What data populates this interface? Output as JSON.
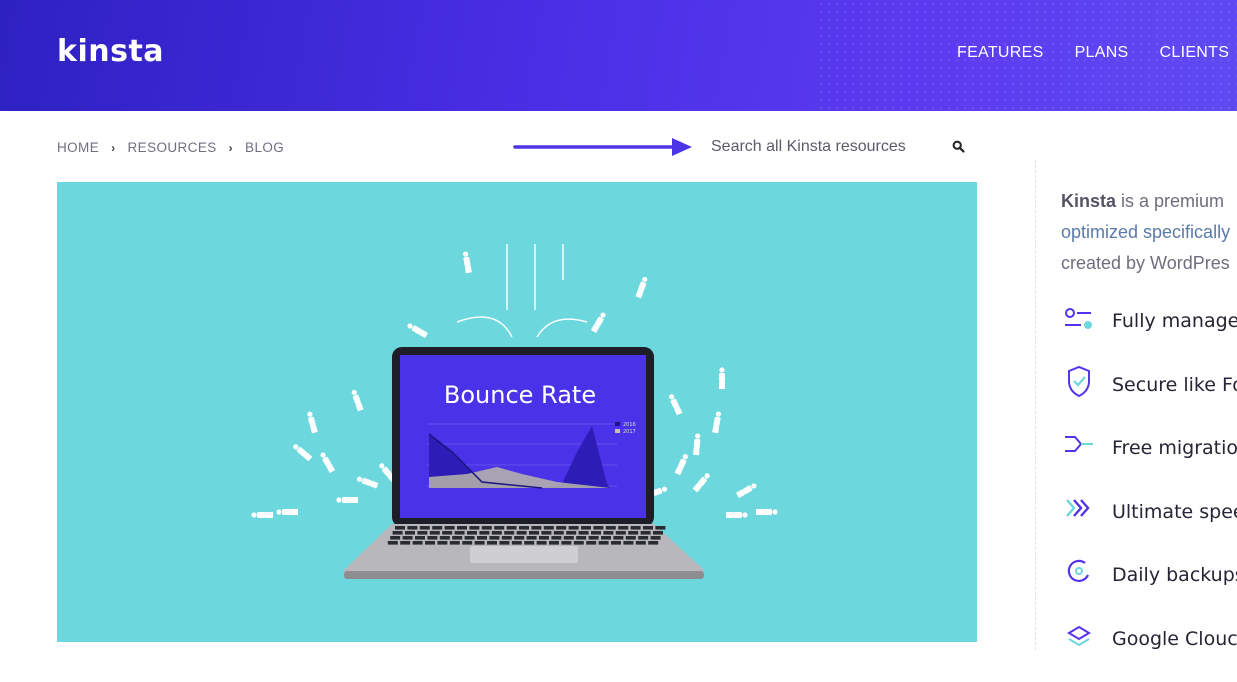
{
  "header": {
    "logo": "kinsta",
    "nav": [
      {
        "label": "FEATURES"
      },
      {
        "label": "PLANS"
      },
      {
        "label": "CLIENTS"
      }
    ]
  },
  "breadcrumb": {
    "items": [
      {
        "label": "HOME"
      },
      {
        "label": "RESOURCES"
      },
      {
        "label": "BLOG"
      }
    ]
  },
  "search": {
    "placeholder": "Search all Kinsta resources",
    "icon": "search-icon"
  },
  "hero": {
    "screen_title": "Bounce Rate",
    "legend": [
      "2016",
      "2017"
    ]
  },
  "sidebar": {
    "intro": {
      "brand": "Kinsta",
      "line1_rest": " is a premium",
      "line2": "optimized specifically",
      "line3": "created by WordPres"
    },
    "features": [
      {
        "label": "Fully manage",
        "icon": "sliders-icon"
      },
      {
        "label": "Secure like Fo",
        "icon": "shield-icon"
      },
      {
        "label": "Free migratio",
        "icon": "migration-arrow-icon"
      },
      {
        "label": "Ultimate spee",
        "icon": "speed-chevrons-icon"
      },
      {
        "label": "Daily backups",
        "icon": "backup-icon"
      },
      {
        "label": "Google Clouc",
        "icon": "cloud-icon"
      }
    ]
  },
  "colors": {
    "header_gradient_start": "#2e21c2",
    "header_gradient_end": "#5f4af2",
    "hero_background": "#6cd7dd",
    "accent": "#5333ed"
  }
}
